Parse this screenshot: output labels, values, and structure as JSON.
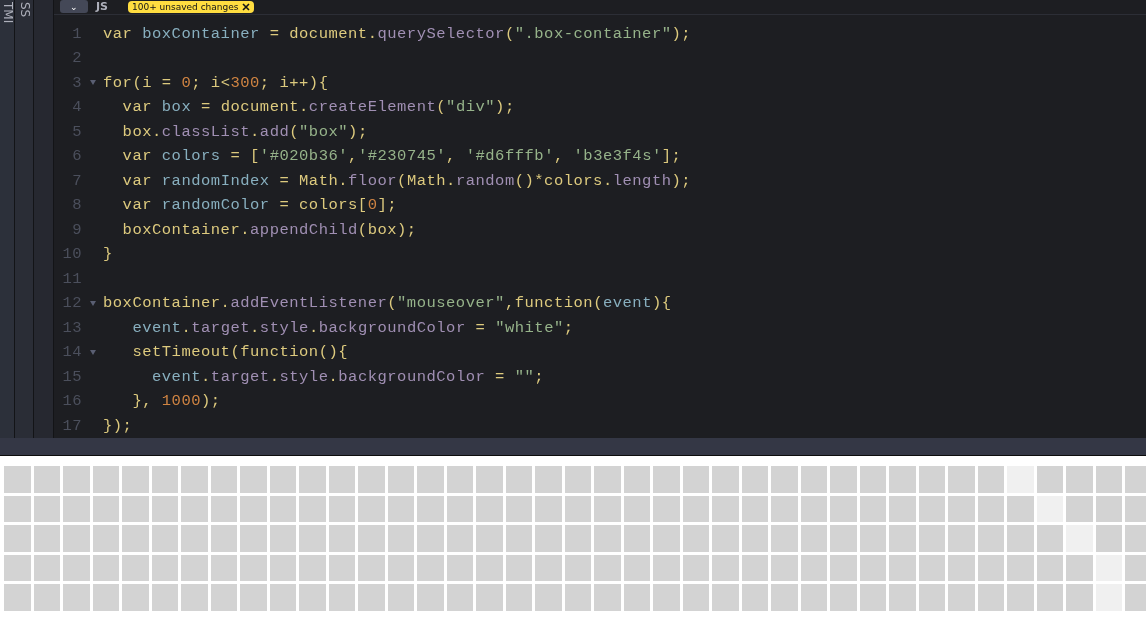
{
  "side_tabs": [
    {
      "label": "TMI"
    },
    {
      "label": "SS"
    }
  ],
  "editor": {
    "header": {
      "menu_button": "⌄",
      "title": "JS",
      "badge": "100+ unsaved changes"
    },
    "lines": [
      {
        "number": "1",
        "foldable": false,
        "tokens": [
          {
            "kind": "keyword",
            "text": "var"
          },
          {
            "kind": "def",
            "text": " boxContainer"
          },
          {
            "kind": "plain",
            "text": " = document."
          },
          {
            "kind": "prop",
            "text": "querySelector"
          },
          {
            "kind": "plain",
            "text": "("
          },
          {
            "kind": "string",
            "text": "\".box-container\""
          },
          {
            "kind": "plain",
            "text": ");"
          }
        ]
      },
      {
        "number": "2",
        "foldable": false
      },
      {
        "number": "3",
        "foldable": true,
        "tokens": [
          {
            "kind": "keyword",
            "text": "for"
          },
          {
            "kind": "plain",
            "text": "(i = "
          },
          {
            "kind": "number",
            "text": "0"
          },
          {
            "kind": "plain",
            "text": "; i<"
          },
          {
            "kind": "number",
            "text": "300"
          },
          {
            "kind": "plain",
            "text": "; i++){"
          }
        ]
      },
      {
        "number": "4",
        "foldable": false,
        "tokens": [
          {
            "kind": "keyword",
            "text": "  var"
          },
          {
            "kind": "def",
            "text": " box"
          },
          {
            "kind": "plain",
            "text": " = document."
          },
          {
            "kind": "prop",
            "text": "createElement"
          },
          {
            "kind": "plain",
            "text": "("
          },
          {
            "kind": "string",
            "text": "\"div\""
          },
          {
            "kind": "plain",
            "text": ");"
          }
        ]
      },
      {
        "number": "5",
        "foldable": false,
        "tokens": [
          {
            "kind": "plain",
            "text": "  box."
          },
          {
            "kind": "prop",
            "text": "classList"
          },
          {
            "kind": "plain",
            "text": "."
          },
          {
            "kind": "prop",
            "text": "add"
          },
          {
            "kind": "plain",
            "text": "("
          },
          {
            "kind": "string",
            "text": "\"box\""
          },
          {
            "kind": "plain",
            "text": ");"
          }
        ]
      },
      {
        "number": "6",
        "foldable": false,
        "tokens": [
          {
            "kind": "keyword",
            "text": "  var"
          },
          {
            "kind": "def",
            "text": " colors"
          },
          {
            "kind": "plain",
            "text": " = ["
          },
          {
            "kind": "string",
            "text": "'#020b36'"
          },
          {
            "kind": "plain",
            "text": ","
          },
          {
            "kind": "string",
            "text": "'#230745'"
          },
          {
            "kind": "plain",
            "text": ", "
          },
          {
            "kind": "string",
            "text": "'#d6fffb'"
          },
          {
            "kind": "plain",
            "text": ", "
          },
          {
            "kind": "string",
            "text": "'b3e3f4s'"
          },
          {
            "kind": "plain",
            "text": "];"
          }
        ]
      },
      {
        "number": "7",
        "foldable": false,
        "tokens": [
          {
            "kind": "keyword",
            "text": "  var"
          },
          {
            "kind": "def",
            "text": " randomIndex"
          },
          {
            "kind": "plain",
            "text": " = Math."
          },
          {
            "kind": "prop",
            "text": "floor"
          },
          {
            "kind": "plain",
            "text": "(Math."
          },
          {
            "kind": "prop",
            "text": "random"
          },
          {
            "kind": "plain",
            "text": "()*colors."
          },
          {
            "kind": "prop",
            "text": "length"
          },
          {
            "kind": "plain",
            "text": ");"
          }
        ]
      },
      {
        "number": "8",
        "foldable": false,
        "tokens": [
          {
            "kind": "keyword",
            "text": "  var"
          },
          {
            "kind": "def",
            "text": " randomColor"
          },
          {
            "kind": "plain",
            "text": " = colors["
          },
          {
            "kind": "number",
            "text": "0"
          },
          {
            "kind": "plain",
            "text": "];"
          }
        ]
      },
      {
        "number": "9",
        "foldable": false,
        "tokens": [
          {
            "kind": "plain",
            "text": "  boxContainer."
          },
          {
            "kind": "prop",
            "text": "appendChild"
          },
          {
            "kind": "plain",
            "text": "(box);"
          }
        ]
      },
      {
        "number": "10",
        "foldable": false,
        "tokens": [
          {
            "kind": "plain",
            "text": "}"
          }
        ]
      },
      {
        "number": "11",
        "foldable": false
      },
      {
        "number": "12",
        "foldable": true,
        "tokens": [
          {
            "kind": "plain",
            "text": "boxContainer."
          },
          {
            "kind": "prop",
            "text": "addEventListener"
          },
          {
            "kind": "plain",
            "text": "("
          },
          {
            "kind": "string",
            "text": "\"mouseover\""
          },
          {
            "kind": "plain",
            "text": ","
          },
          {
            "kind": "keyword",
            "text": "function"
          },
          {
            "kind": "plain",
            "text": "("
          },
          {
            "kind": "def",
            "text": "event"
          },
          {
            "kind": "plain",
            "text": "){"
          }
        ]
      },
      {
        "number": "13",
        "foldable": false,
        "tokens": [
          {
            "kind": "def",
            "text": "   event"
          },
          {
            "kind": "plain",
            "text": "."
          },
          {
            "kind": "prop",
            "text": "target"
          },
          {
            "kind": "plain",
            "text": "."
          },
          {
            "kind": "prop",
            "text": "style"
          },
          {
            "kind": "plain",
            "text": "."
          },
          {
            "kind": "prop",
            "text": "backgroundColor"
          },
          {
            "kind": "plain",
            "text": " = "
          },
          {
            "kind": "string",
            "text": "\"white\""
          },
          {
            "kind": "plain",
            "text": ";"
          }
        ]
      },
      {
        "number": "14",
        "foldable": true,
        "tokens": [
          {
            "kind": "plain",
            "text": "   setTimeout("
          },
          {
            "kind": "keyword",
            "text": "function"
          },
          {
            "kind": "plain",
            "text": "(){"
          }
        ]
      },
      {
        "number": "15",
        "foldable": false,
        "tokens": [
          {
            "kind": "def",
            "text": "     event"
          },
          {
            "kind": "plain",
            "text": "."
          },
          {
            "kind": "prop",
            "text": "target"
          },
          {
            "kind": "plain",
            "text": "."
          },
          {
            "kind": "prop",
            "text": "style"
          },
          {
            "kind": "plain",
            "text": "."
          },
          {
            "kind": "prop",
            "text": "backgroundColor"
          },
          {
            "kind": "plain",
            "text": " = "
          },
          {
            "kind": "string",
            "text": "\"\""
          },
          {
            "kind": "plain",
            "text": ";"
          }
        ]
      },
      {
        "number": "16",
        "foldable": false,
        "tokens": [
          {
            "kind": "plain",
            "text": "   }, "
          },
          {
            "kind": "number",
            "text": "1000"
          },
          {
            "kind": "plain",
            "text": ");"
          }
        ]
      },
      {
        "number": "17",
        "foldable": false,
        "tokens": [
          {
            "kind": "plain",
            "text": "});"
          }
        ]
      }
    ]
  },
  "preview": {
    "rows": [
      {
        "highlighted": [
          false,
          false,
          false,
          false,
          false,
          false,
          false,
          false,
          false,
          false,
          false,
          false,
          false,
          false,
          false,
          false,
          false,
          false,
          false,
          false,
          false,
          false,
          false,
          false,
          false,
          false,
          false,
          false,
          false,
          false,
          false,
          false,
          false,
          false,
          true,
          false,
          false,
          false,
          false
        ]
      },
      {
        "highlighted": [
          false,
          false,
          false,
          false,
          false,
          false,
          false,
          false,
          false,
          false,
          false,
          false,
          false,
          false,
          false,
          false,
          false,
          false,
          false,
          false,
          false,
          false,
          false,
          false,
          false,
          false,
          false,
          false,
          false,
          false,
          false,
          false,
          false,
          false,
          false,
          true,
          false,
          false,
          false
        ]
      },
      {
        "highlighted": [
          false,
          false,
          false,
          false,
          false,
          false,
          false,
          false,
          false,
          false,
          false,
          false,
          false,
          false,
          false,
          false,
          false,
          false,
          false,
          false,
          false,
          false,
          false,
          false,
          false,
          false,
          false,
          false,
          false,
          false,
          false,
          false,
          false,
          false,
          false,
          false,
          true,
          false,
          false
        ]
      },
      {
        "highlighted": [
          false,
          false,
          false,
          false,
          false,
          false,
          false,
          false,
          false,
          false,
          false,
          false,
          false,
          false,
          false,
          false,
          false,
          false,
          false,
          false,
          false,
          false,
          false,
          false,
          false,
          false,
          false,
          false,
          false,
          false,
          false,
          false,
          false,
          false,
          false,
          false,
          false,
          true,
          false
        ]
      },
      {
        "highlighted": [
          false,
          false,
          false,
          false,
          false,
          false,
          false,
          false,
          false,
          false,
          false,
          false,
          false,
          false,
          false,
          false,
          false,
          false,
          false,
          false,
          false,
          false,
          false,
          false,
          false,
          false,
          false,
          false,
          false,
          false,
          false,
          false,
          false,
          false,
          false,
          false,
          false,
          true,
          false
        ]
      }
    ]
  }
}
